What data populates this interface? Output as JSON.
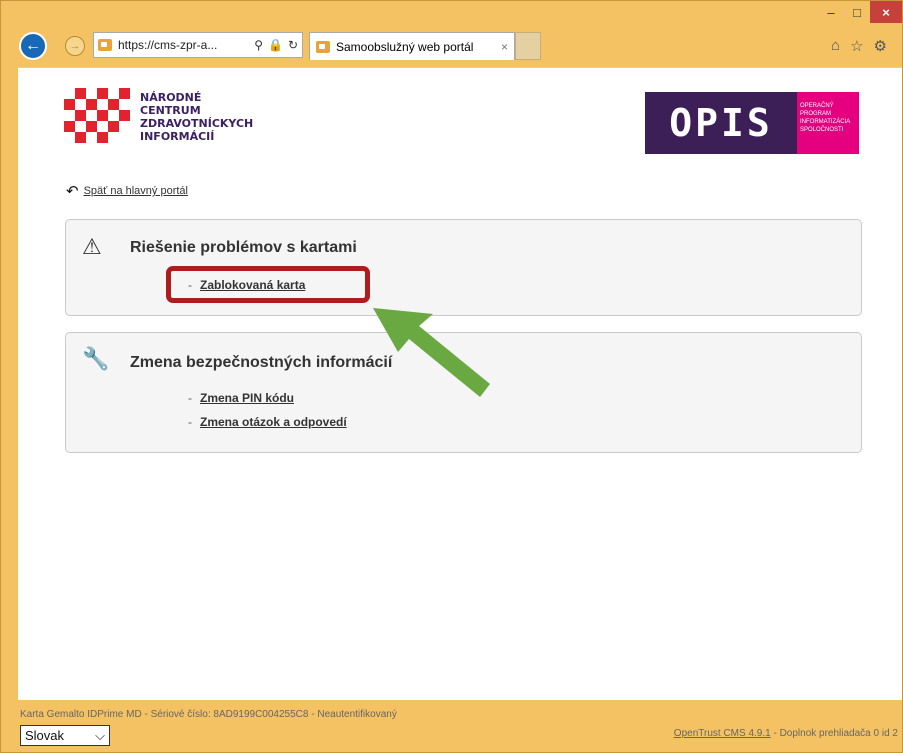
{
  "browser": {
    "address_url": "https://cms-zpr-a...",
    "tab_title": "Samoobslužný web portál",
    "tab_close": "×",
    "window_controls": {
      "minimize": "–",
      "maximize": "□",
      "close": "×"
    },
    "toolbar_icons": [
      "home-icon",
      "star-icon",
      "gear-icon"
    ]
  },
  "header": {
    "nczi_logo_lines": [
      "NÁRODNÉ",
      "CENTRUM",
      "ZDRAVOTNÍCKYCH",
      "INFORMÁCIÍ"
    ],
    "opis_logo_text": "OPIS",
    "opis_logo_lines": [
      "OPERAČNÝ",
      "PROGRAM",
      "INFORMATIZÁCIA",
      "SPOLOČNOSTI"
    ]
  },
  "back_link": "Späť na hlavný portál",
  "sections": [
    {
      "title": "Riešenie problémov s kartami",
      "icon": "warning-icon",
      "links": [
        "Zablokovaná karta"
      ]
    },
    {
      "title": "Zmena bezpečnostných informácií",
      "icon": "wrench-icon",
      "links": [
        "Zmena PIN kódu",
        "Zmena otázok a odpovedí"
      ]
    }
  ],
  "footer": {
    "card_info": "Karta Gemalto IDPrime MD - Sériové číslo: 8AD9199C004255C8 - Neautentifikovaný",
    "language": "Slovak",
    "product_link": "OpenTrust CMS 4.9.1",
    "addon_info": " - Doplnok prehliadača 0 id 2"
  },
  "colors": {
    "highlight": "#b01b1b",
    "arrow": "#6aa842",
    "nczi_red": "#e2232e",
    "opis_purple": "#3d1f57",
    "opis_pink": "#e4007f"
  }
}
